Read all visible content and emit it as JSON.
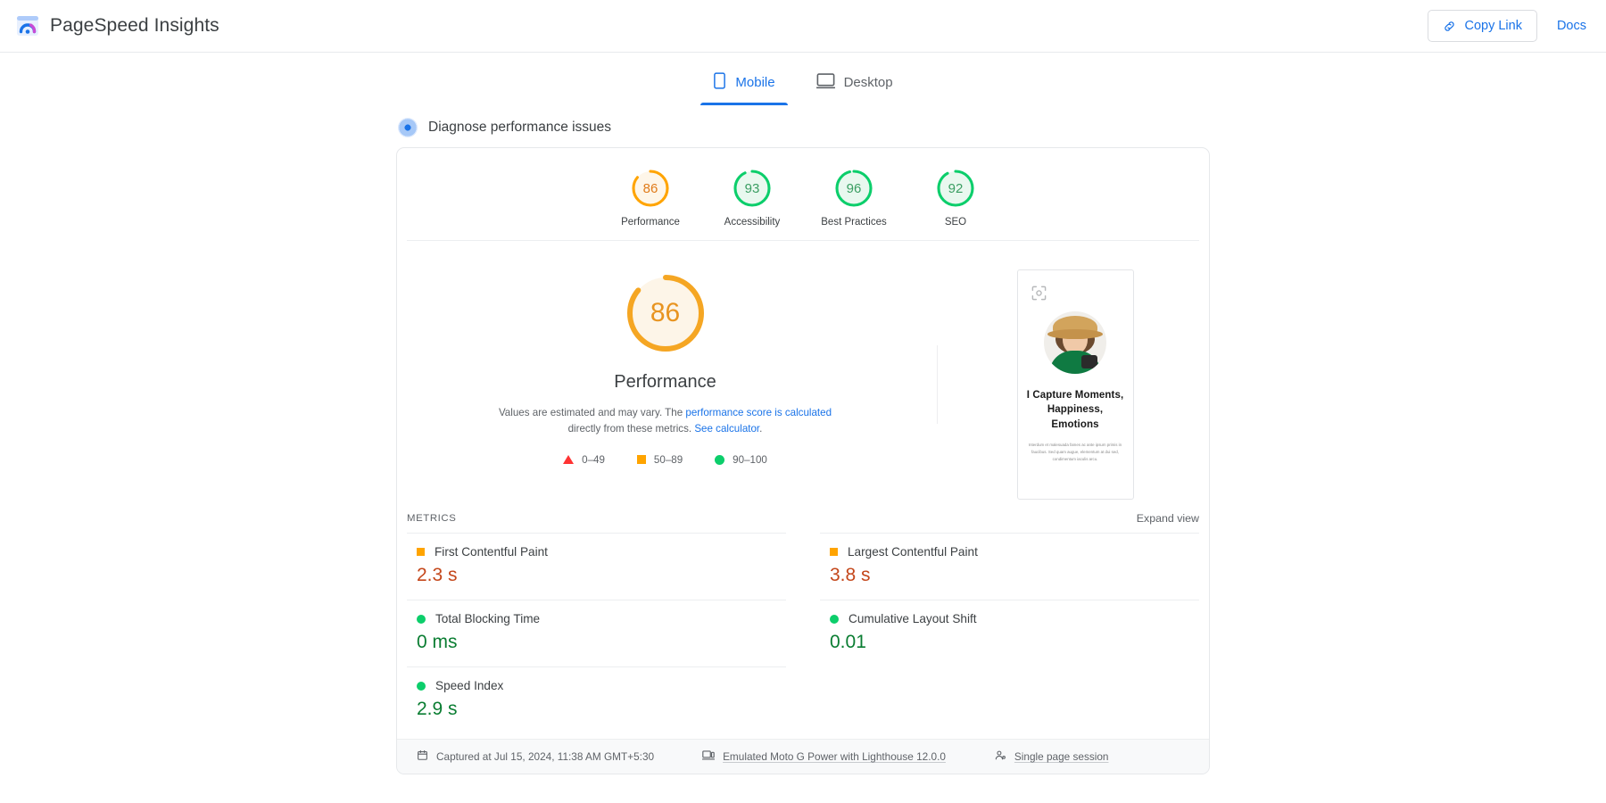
{
  "header": {
    "logo_icon": "pagespeed-logo",
    "title": "PageSpeed Insights",
    "copy_link_label": "Copy Link",
    "copy_link_icon": "link-icon",
    "docs_label": "Docs"
  },
  "tabs": [
    {
      "label": "Mobile",
      "icon": "mobile-icon",
      "active": true
    },
    {
      "label": "Desktop",
      "icon": "desktop-icon",
      "active": false
    }
  ],
  "diagnose": {
    "label": "Diagnose performance issues",
    "icon": "loading-dot-icon"
  },
  "category_scores": [
    {
      "label": "Performance",
      "value": "86",
      "color": "#ffa400",
      "track": "#fef6e9"
    },
    {
      "label": "Accessibility",
      "value": "93",
      "color": "#0cce6b",
      "track": "#e9f8ef"
    },
    {
      "label": "Best Practices",
      "value": "96",
      "color": "#0cce6b",
      "track": "#e9f8ef"
    },
    {
      "label": "SEO",
      "value": "92",
      "color": "#0cce6b",
      "track": "#e9f8ef"
    }
  ],
  "main_gauge": {
    "value": "86",
    "label": "Performance",
    "color": "#f5a623",
    "track": "#fdf5e8"
  },
  "estimate_note": {
    "part1": "Values are estimated and may vary. The ",
    "link1": "performance score is calculated",
    "part2": " directly from these metrics. ",
    "link2": "See calculator",
    "part3": "."
  },
  "legend": [
    {
      "shape": "triangle",
      "label": "0–49",
      "color": "#ff3333"
    },
    {
      "shape": "square",
      "label": "50–89",
      "color": "#ffa400"
    },
    {
      "shape": "circle",
      "label": "90–100",
      "color": "#0cce6b"
    }
  ],
  "screenshot": {
    "expand_icon": "expand-screenshot-icon",
    "heading": "I Capture Moments, Happiness, Emotions",
    "body": "Interdum et malesuada fames ac ante ipsum primis in faucibus. Sed quam augue, elementum at dui sed, condimentum iaculis arcu.",
    "photo_alt": "woman-with-camera-photo"
  },
  "metrics_section": {
    "title": "METRICS",
    "expand_view_label": "Expand view"
  },
  "metrics": [
    {
      "name": "First Contentful Paint",
      "value": "2.3 s",
      "status": "average",
      "shape": "square",
      "value_color": "#c4471b"
    },
    {
      "name": "Largest Contentful Paint",
      "value": "3.8 s",
      "status": "average",
      "shape": "square",
      "value_color": "#c4471b"
    },
    {
      "name": "Total Blocking Time",
      "value": "0 ms",
      "status": "good",
      "shape": "circle",
      "value_color": "#0a7d32"
    },
    {
      "name": "Cumulative Layout Shift",
      "value": "0.01",
      "status": "good",
      "shape": "circle",
      "value_color": "#0a7d32"
    },
    {
      "name": "Speed Index",
      "value": "2.9 s",
      "status": "good",
      "shape": "circle",
      "value_color": "#0a7d32"
    }
  ],
  "footer": [
    {
      "icon": "calendar-icon",
      "label": "Captured at Jul 15, 2024, 11:38 AM GMT+5:30",
      "underline": false
    },
    {
      "icon": "device-icon",
      "label": "Emulated Moto G Power with Lighthouse 12.0.0",
      "underline": true
    },
    {
      "icon": "session-icon",
      "label": "Single page session",
      "underline": true
    }
  ]
}
